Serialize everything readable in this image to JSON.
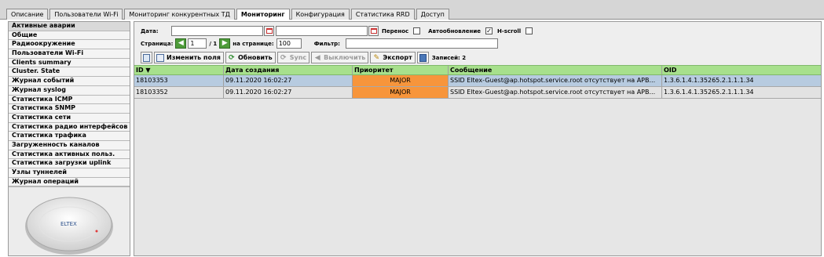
{
  "tabs": [
    {
      "label": "Описание",
      "active": false
    },
    {
      "label": "Пользователи Wi-Fi",
      "active": false
    },
    {
      "label": "Мониторинг конкурентных ТД",
      "active": false
    },
    {
      "label": "Мониторинг",
      "active": true
    },
    {
      "label": "Конфигурация",
      "active": false
    },
    {
      "label": "Статистика RRD",
      "active": false
    },
    {
      "label": "Доступ",
      "active": false
    }
  ],
  "sidebar": {
    "items": [
      "Активные аварии",
      "Общие",
      "Радиоокружение",
      "Пользователи Wi-Fi",
      "Clients summary",
      "Cluster. State",
      "Журнал событий",
      "Журнал syslog",
      "Статистика ICMP",
      "Статистика SNMP",
      "Статистика сети",
      "Статистика радио интерфейсов",
      "Статистика трафика",
      "Загруженность каналов",
      "Статистика активных польз.",
      "Статистика загрузки uplink",
      "Узлы туннелей",
      "Журнал операций"
    ],
    "device_logo": "ELTEX"
  },
  "filters": {
    "date_label": "Дата:",
    "date_from": "",
    "date_to": "",
    "wrap_label": "Перенос",
    "wrap_checked": "",
    "autoupdate_label": "Автообновление",
    "autoupdate_checked": "✓",
    "hscroll_label": "H-scroll",
    "hscroll_checked": "",
    "page_label": "Страница:",
    "page_value": "1",
    "page_total": "/ 1",
    "per_page_label": "на странице:",
    "per_page_value": "100",
    "filter_label": "Фильтр:",
    "filter_value": ""
  },
  "toolbar": {
    "edit_fields": "Изменить поля",
    "refresh": "Обновить",
    "sync": "Sync",
    "disable": "Выключить",
    "export": "Экспорт",
    "records": "Записей: 2"
  },
  "grid": {
    "headers": [
      "ID ▼",
      "Дата создания",
      "Приоритет",
      "Сообщение",
      "OID"
    ],
    "rows": [
      [
        "18103353",
        "09.11.2020 16:02:27",
        "MAJOR",
        "SSID Eltex-Guest@ap.hotspot.service.root отсутствует на АРВ...",
        "1.3.6.1.4.1.35265.2.1.1.1.34"
      ],
      [
        "18103352",
        "09.11.2020 16:02:27",
        "MAJOR",
        "SSID Eltex-Guest@ap.hotspot.service.root отсутствует на АРВ...",
        "1.3.6.1.4.1.35265.2.1.1.1.34"
      ]
    ]
  },
  "colors": {
    "header_green": "#a7e08c",
    "priority_major": "#f7953b",
    "selected_row": "#b7cbe0"
  }
}
